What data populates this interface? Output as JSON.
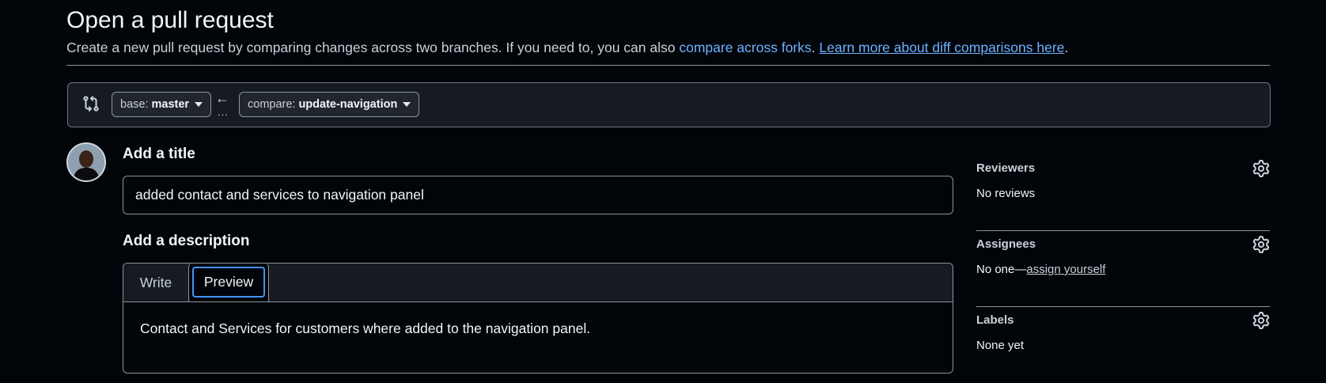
{
  "page": {
    "title": "Open a pull request",
    "subtitle_text": "Create a new pull request by comparing changes across two branches. If you need to, you can also",
    "compare_forks_link": "compare across forks",
    "period1": ".",
    "learn_more_link": "Learn more about diff comparisons here",
    "period2": "."
  },
  "compare_bar": {
    "base_prefix": "base:",
    "base_branch": "master",
    "compare_prefix": "compare:",
    "compare_branch": "update-navigation",
    "arrow": "←",
    "dots": "..."
  },
  "form": {
    "title_heading": "Add a title",
    "title_value": "added contact and services to navigation panel",
    "description_heading": "Add a description",
    "tabs": [
      {
        "label": "Write"
      },
      {
        "label": "Preview"
      }
    ],
    "preview_text": "Contact and Services for customers where added to the navigation panel."
  },
  "sidebar": {
    "reviewers": {
      "title": "Reviewers",
      "value": "No reviews"
    },
    "assignees": {
      "title": "Assignees",
      "value": "No one—",
      "link": "assign yourself"
    },
    "labels": {
      "title": "Labels",
      "value": "None yet"
    }
  },
  "colors": {
    "background": "#010409",
    "link": "#6fb3ff",
    "focus": "#4493f8"
  }
}
